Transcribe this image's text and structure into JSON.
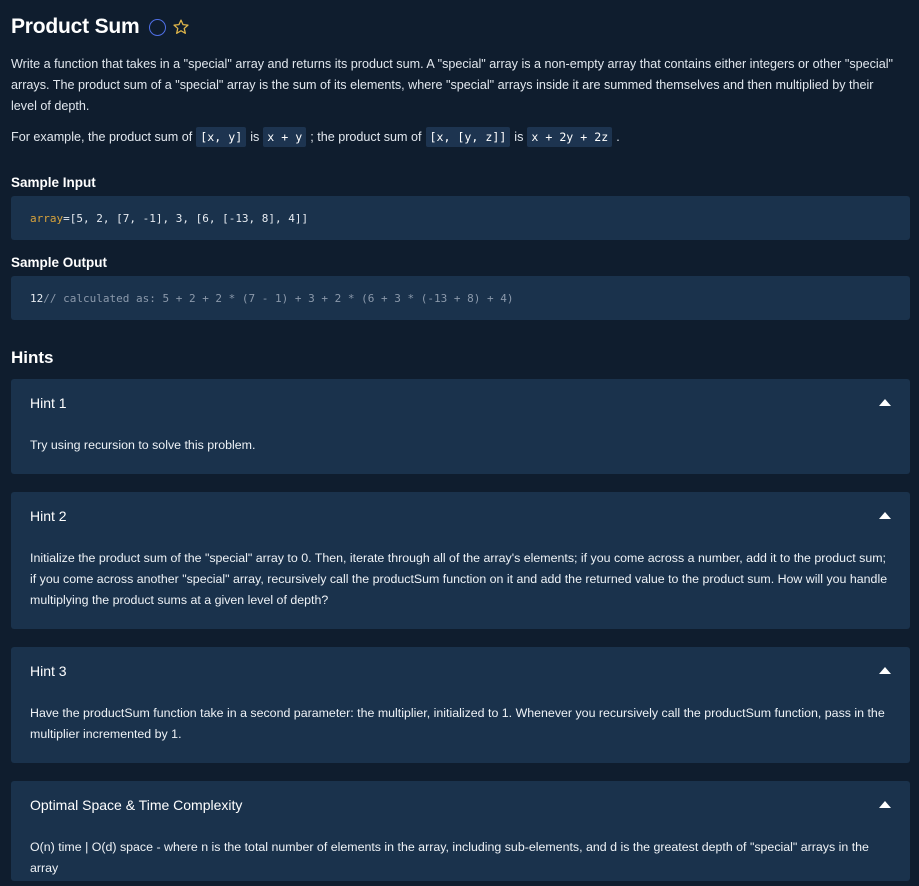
{
  "problem": {
    "title": "Product Sum",
    "description": "Write a function that takes in a \"special\" array and returns its product sum. A \"special\" array is a non-empty array that contains either integers or other \"special\" arrays. The product sum of a \"special\" array is the sum of its elements, where \"special\" arrays inside it are summed themselves and then multiplied by their level of depth.",
    "example": {
      "t1": "For example, the product sum of",
      "c1": "[x, y]",
      "t2": "is",
      "c2": "x + y",
      "t3": "; the product sum of",
      "c3": "[x, [y, z]]",
      "t4": "is",
      "c4": "x + 2y + 2z",
      "t5": "."
    }
  },
  "sample_input": {
    "label": "Sample Input",
    "var": "array",
    "eq": "=",
    "value": "[5, 2, [7, -1], 3, [6, [-13, 8], 4]]"
  },
  "sample_output": {
    "label": "Sample Output",
    "value": "12",
    "comment": "// calculated as: 5 + 2 + 2 * (7 - 1) + 3 + 2 * (6 + 3 * (-13 + 8) + 4)"
  },
  "hints": {
    "title": "Hints",
    "items": [
      {
        "title": "Hint 1",
        "body": "Try using recursion to solve this problem."
      },
      {
        "title": "Hint 2",
        "body": "Initialize the product sum of the \"special\" array to 0. Then, iterate through all of the array's elements; if you come across a number, add it to the product sum; if you come across another \"special\" array, recursively call the productSum function on it and add the returned value to the product sum. How will you handle multiplying the product sums at a given level of depth?"
      },
      {
        "title": "Hint 3",
        "body": "Have the productSum function take in a second parameter: the multiplier, initialized to 1. Whenever you recursively call the productSum function, pass in the multiplier incremented by 1."
      },
      {
        "title": "Optimal Space & Time Complexity",
        "body": "O(n) time | O(d) space - where n is the total number of elements in the array, including sub-elements, and d is the greatest depth of \"special\" arrays in the array"
      }
    ]
  },
  "colors": {
    "background": "#0f1d2e",
    "panel": "#1a324c",
    "keyword": "#d8a33b",
    "accent_circle": "#4f6fe6",
    "star": "#e0b64a"
  }
}
